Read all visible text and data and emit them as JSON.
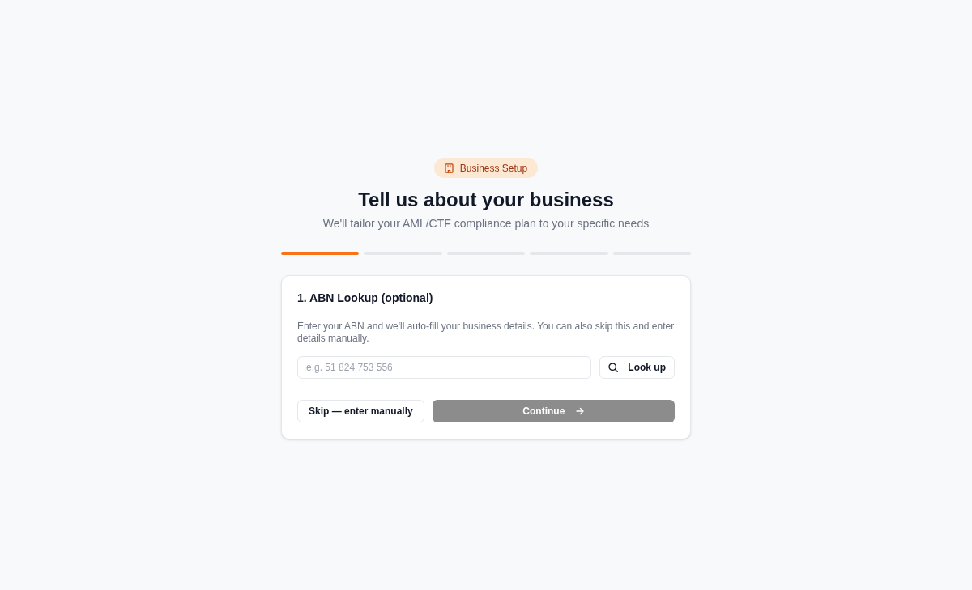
{
  "badge": {
    "label": "Business Setup"
  },
  "title": "Tell us about your business",
  "subtitle": "We'll tailor your AML/CTF compliance plan to your specific needs",
  "progress_steps": [
    {
      "done": true
    },
    {
      "done": false
    },
    {
      "done": false
    },
    {
      "done": false
    },
    {
      "done": false
    }
  ],
  "card": {
    "heading": "1. ABN Lookup (optional)",
    "description": "Enter your ABN and we'll auto-fill your business details. You can also skip this and enter details manually.",
    "abn_field": {
      "placeholder": "e.g. 51 824 753 556"
    },
    "lookup_button": {
      "label": "Look up"
    },
    "skip_button": {
      "label": "Skip — enter manually"
    },
    "continue_button": {
      "label": "Continue",
      "disabled": true
    }
  }
}
